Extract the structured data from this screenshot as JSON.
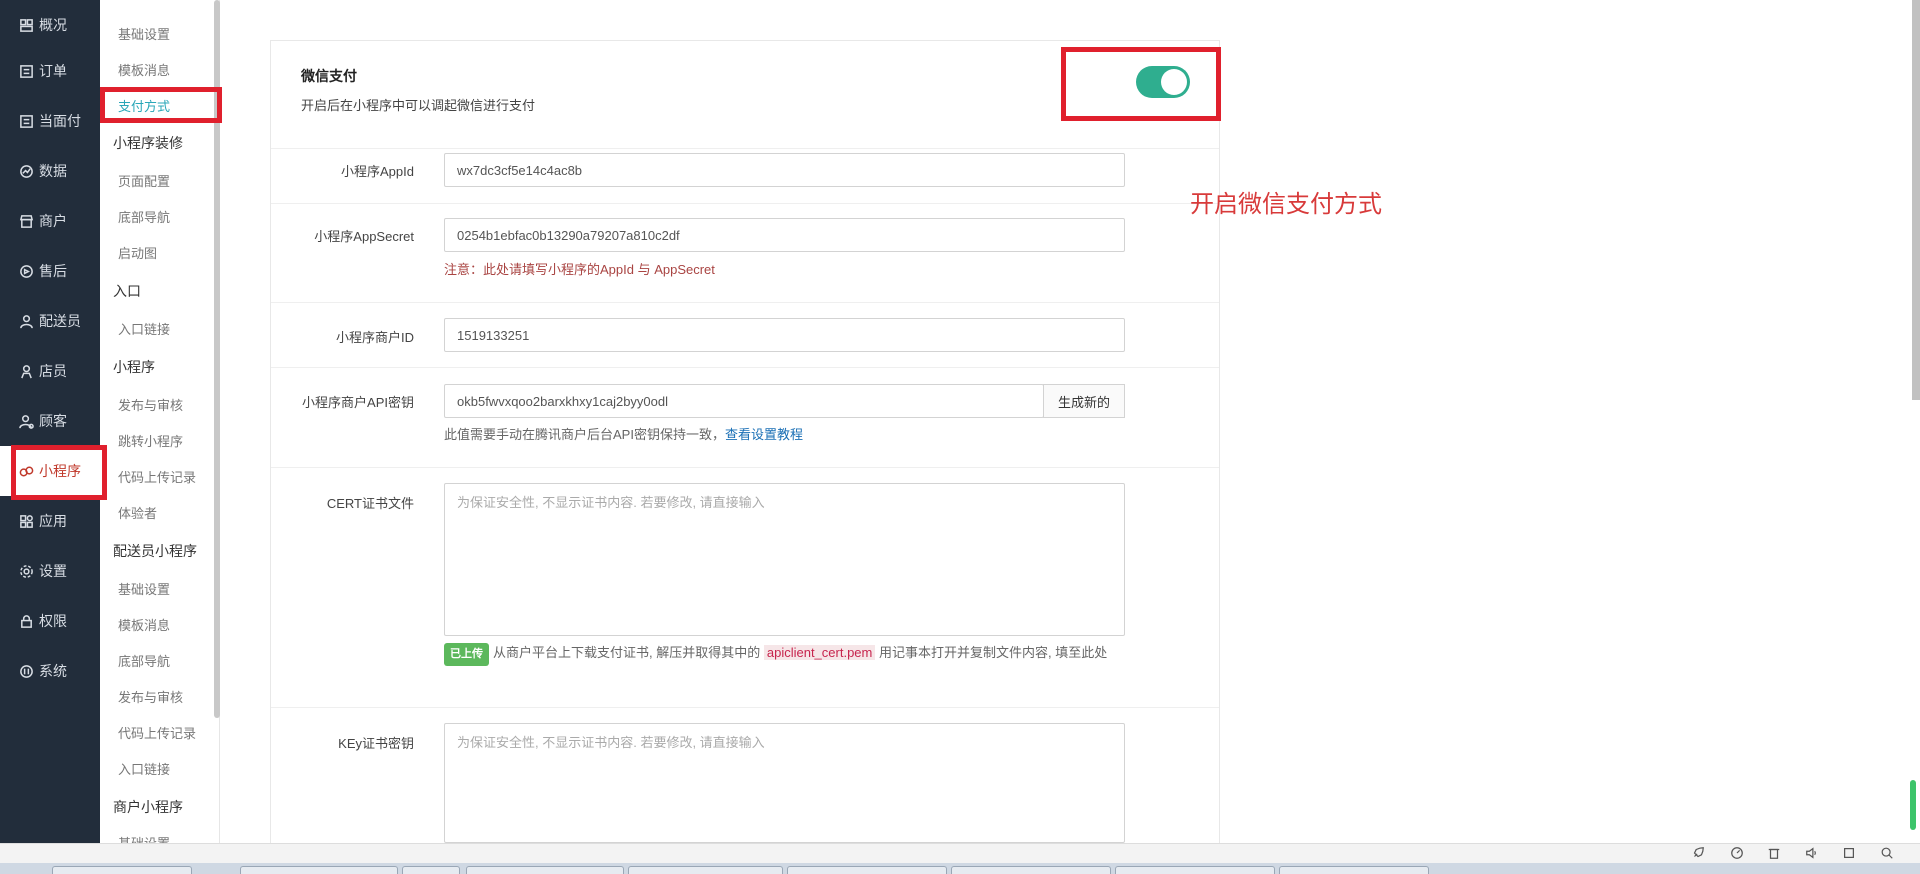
{
  "nav": {
    "items": [
      {
        "label": "概况",
        "icon": "overview-icon"
      },
      {
        "label": "订单",
        "icon": "order-icon"
      },
      {
        "label": "当面付",
        "icon": "pay-icon"
      },
      {
        "label": "数据",
        "icon": "chart-icon"
      },
      {
        "label": "商户",
        "icon": "store-icon"
      },
      {
        "label": "售后",
        "icon": "aftersale-icon"
      },
      {
        "label": "配送员",
        "icon": "courier-icon"
      },
      {
        "label": "店员",
        "icon": "clerk-icon"
      },
      {
        "label": "顾客",
        "icon": "customer-icon"
      },
      {
        "label": "小程序",
        "icon": "miniprogram-icon"
      },
      {
        "label": "应用",
        "icon": "apps-icon"
      },
      {
        "label": "设置",
        "icon": "gear-icon"
      },
      {
        "label": "权限",
        "icon": "lock-icon"
      },
      {
        "label": "系统",
        "icon": "system-icon"
      }
    ]
  },
  "subnav": {
    "groups": [
      {
        "items": [
          "基础设置",
          "模板消息",
          "支付方式"
        ]
      },
      {
        "head": "小程序装修",
        "items": [
          "页面配置",
          "底部导航",
          "启动图"
        ]
      },
      {
        "head": "入口",
        "items": [
          "入口链接"
        ]
      },
      {
        "head": "小程序",
        "items": [
          "发布与审核",
          "跳转小程序",
          "代码上传记录",
          "体验者"
        ]
      },
      {
        "head": "配送员小程序",
        "items": [
          "基础设置",
          "模板消息",
          "底部导航",
          "发布与审核",
          "代码上传记录",
          "入口链接"
        ]
      },
      {
        "head": "商户小程序",
        "items": [
          "基础设置"
        ]
      }
    ]
  },
  "wechat_pay": {
    "title": "微信支付",
    "desc": "开启后在小程序中可以调起微信进行支付",
    "enabled": true
  },
  "form": {
    "appid_label": "小程序AppId",
    "appid_value": "wx7dc3cf5e14c4ac8b",
    "secret_label": "小程序AppSecret",
    "secret_value": "0254b1ebfac0b13290a79207a810c2df",
    "secret_note": "注意：此处请填写小程序的AppId 与 AppSecret",
    "mchid_label": "小程序商户ID",
    "mchid_value": "1519133251",
    "apikey_label": "小程序商户API密钥",
    "apikey_value": "okb5fwvxqoo2barxkhxy1caj2byy0odl",
    "apikey_button": "生成新的",
    "apikey_note": "此值需要手动在腾讯商户后台API密钥保持一致，",
    "apikey_link": "查看设置教程",
    "cert_label": "CERT证书文件",
    "cert_placeholder": "为保证安全性, 不显示证书内容. 若要修改, 请直接输入",
    "cert_badge": "已上传",
    "cert_note_1": "从商户平台上下载支付证书, 解压并取得其中的",
    "cert_note_file": "apiclient_cert.pem",
    "cert_note_2": "用记事本打开并复制文件内容, 填至此处",
    "key_label": "KEy证书密钥",
    "key_placeholder": "为保证安全性, 不显示证书内容. 若要修改, 请直接输入"
  },
  "annotation": "开启微信支付方式",
  "colors": {
    "nav_bg": "#222d3b",
    "active_sub": "#2aa7b8",
    "toggle_on": "#2fae8f",
    "highlight": "#e0202d"
  }
}
